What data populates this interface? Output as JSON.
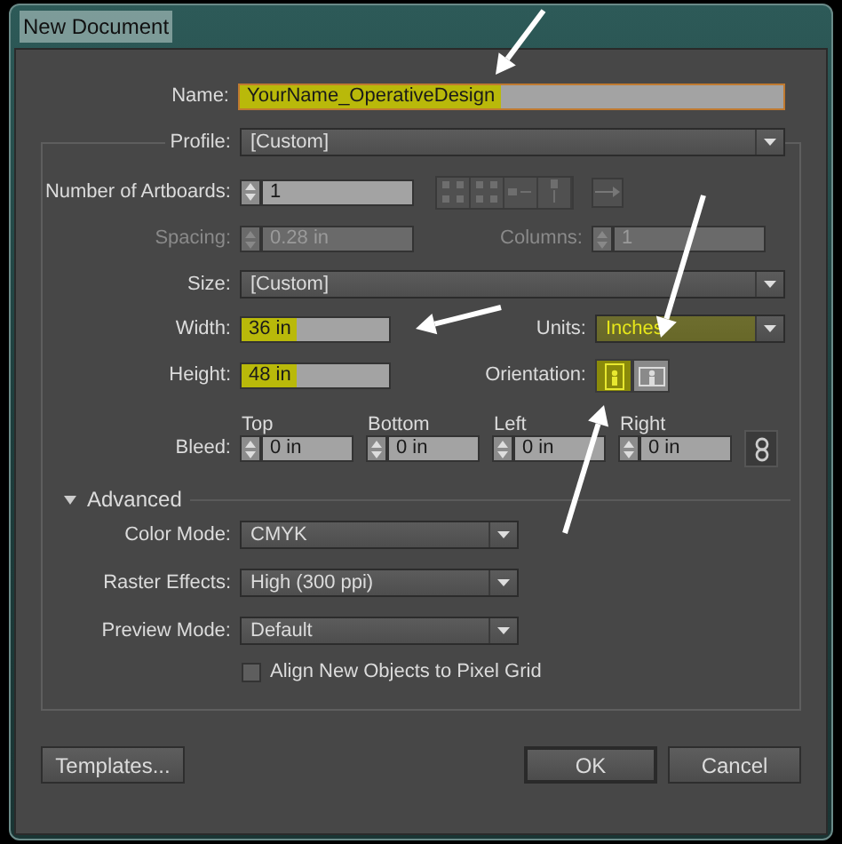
{
  "window": {
    "title": "New Document"
  },
  "name": {
    "label": "Name:",
    "value": "YourName_OperativeDesign",
    "highlighted": true
  },
  "profile": {
    "label": "Profile:",
    "value": "[Custom]"
  },
  "artboards": {
    "label": "Number of Artboards:",
    "value": "1"
  },
  "spacing": {
    "label": "Spacing:",
    "value": "0.28 in",
    "disabled": true
  },
  "columns": {
    "label": "Columns:",
    "value": "1",
    "disabled": true
  },
  "size": {
    "label": "Size:",
    "value": "[Custom]"
  },
  "width": {
    "label": "Width:",
    "value": "36 in",
    "highlighted": true
  },
  "units": {
    "label": "Units:",
    "value": "Inches",
    "highlighted": true
  },
  "height": {
    "label": "Height:",
    "value": "48 in",
    "highlighted": true
  },
  "orientation": {
    "label": "Orientation:",
    "options": [
      {
        "kind": "portrait",
        "selected": true
      },
      {
        "kind": "landscape",
        "selected": false
      }
    ]
  },
  "bleed": {
    "label": "Bleed:",
    "fields": [
      {
        "label": "Top",
        "value": "0 in"
      },
      {
        "label": "Bottom",
        "value": "0 in"
      },
      {
        "label": "Left",
        "value": "0 in"
      },
      {
        "label": "Right",
        "value": "0 in"
      }
    ]
  },
  "advanced": {
    "label": "Advanced",
    "expanded": true
  },
  "color_mode": {
    "label": "Color Mode:",
    "value": "CMYK"
  },
  "raster_effects": {
    "label": "Raster Effects:",
    "value": "High (300 ppi)"
  },
  "preview_mode": {
    "label": "Preview Mode:",
    "value": "Default"
  },
  "align_pixel_grid": {
    "label": "Align New Objects to Pixel Grid",
    "checked": false
  },
  "buttons": [
    {
      "label": "Templates...",
      "default": false
    },
    {
      "label": "OK",
      "default": true
    },
    {
      "label": "Cancel",
      "default": false
    }
  ]
}
